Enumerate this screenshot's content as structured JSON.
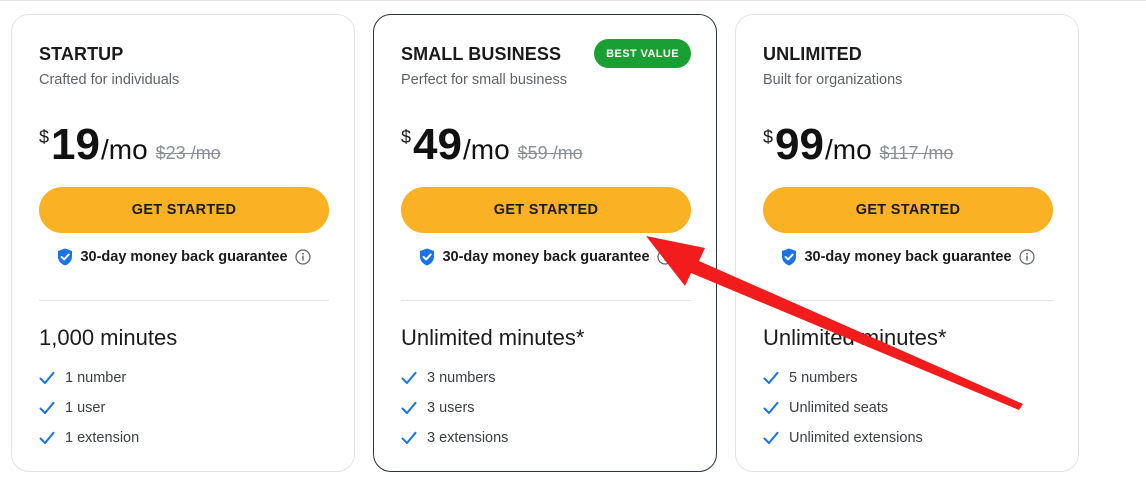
{
  "colors": {
    "accent_button": "#fbb124",
    "badge": "#1aa032",
    "shield": "#1a73e8",
    "check": "#1a73e8",
    "arrow": "#f21c1c"
  },
  "plans": [
    {
      "name": "STARTUP",
      "description": "Crafted for individuals",
      "currency": "$",
      "price": "19",
      "period": "/mo",
      "old_price": "$23 /mo",
      "cta": "GET STARTED",
      "guarantee": "30-day money back guarantee",
      "minutes": "1,000 minutes",
      "features": [
        "1 number",
        "1 user",
        "1 extension"
      ]
    },
    {
      "name": "SMALL BUSINESS",
      "badge": "BEST VALUE",
      "description": "Perfect for small business",
      "currency": "$",
      "price": "49",
      "period": "/mo",
      "old_price": "$59 /mo",
      "cta": "GET STARTED",
      "guarantee": "30-day money back guarantee",
      "minutes": "Unlimited minutes*",
      "features": [
        "3 numbers",
        "3 users",
        "3 extensions"
      ]
    },
    {
      "name": "UNLIMITED",
      "description": "Built for organizations",
      "currency": "$",
      "price": "99",
      "period": "/mo",
      "old_price": "$117 /mo",
      "cta": "GET STARTED",
      "guarantee": "30-day money back guarantee",
      "minutes": "Unlimited minutes*",
      "features": [
        "5 numbers",
        "Unlimited seats",
        "Unlimited extensions"
      ]
    }
  ]
}
